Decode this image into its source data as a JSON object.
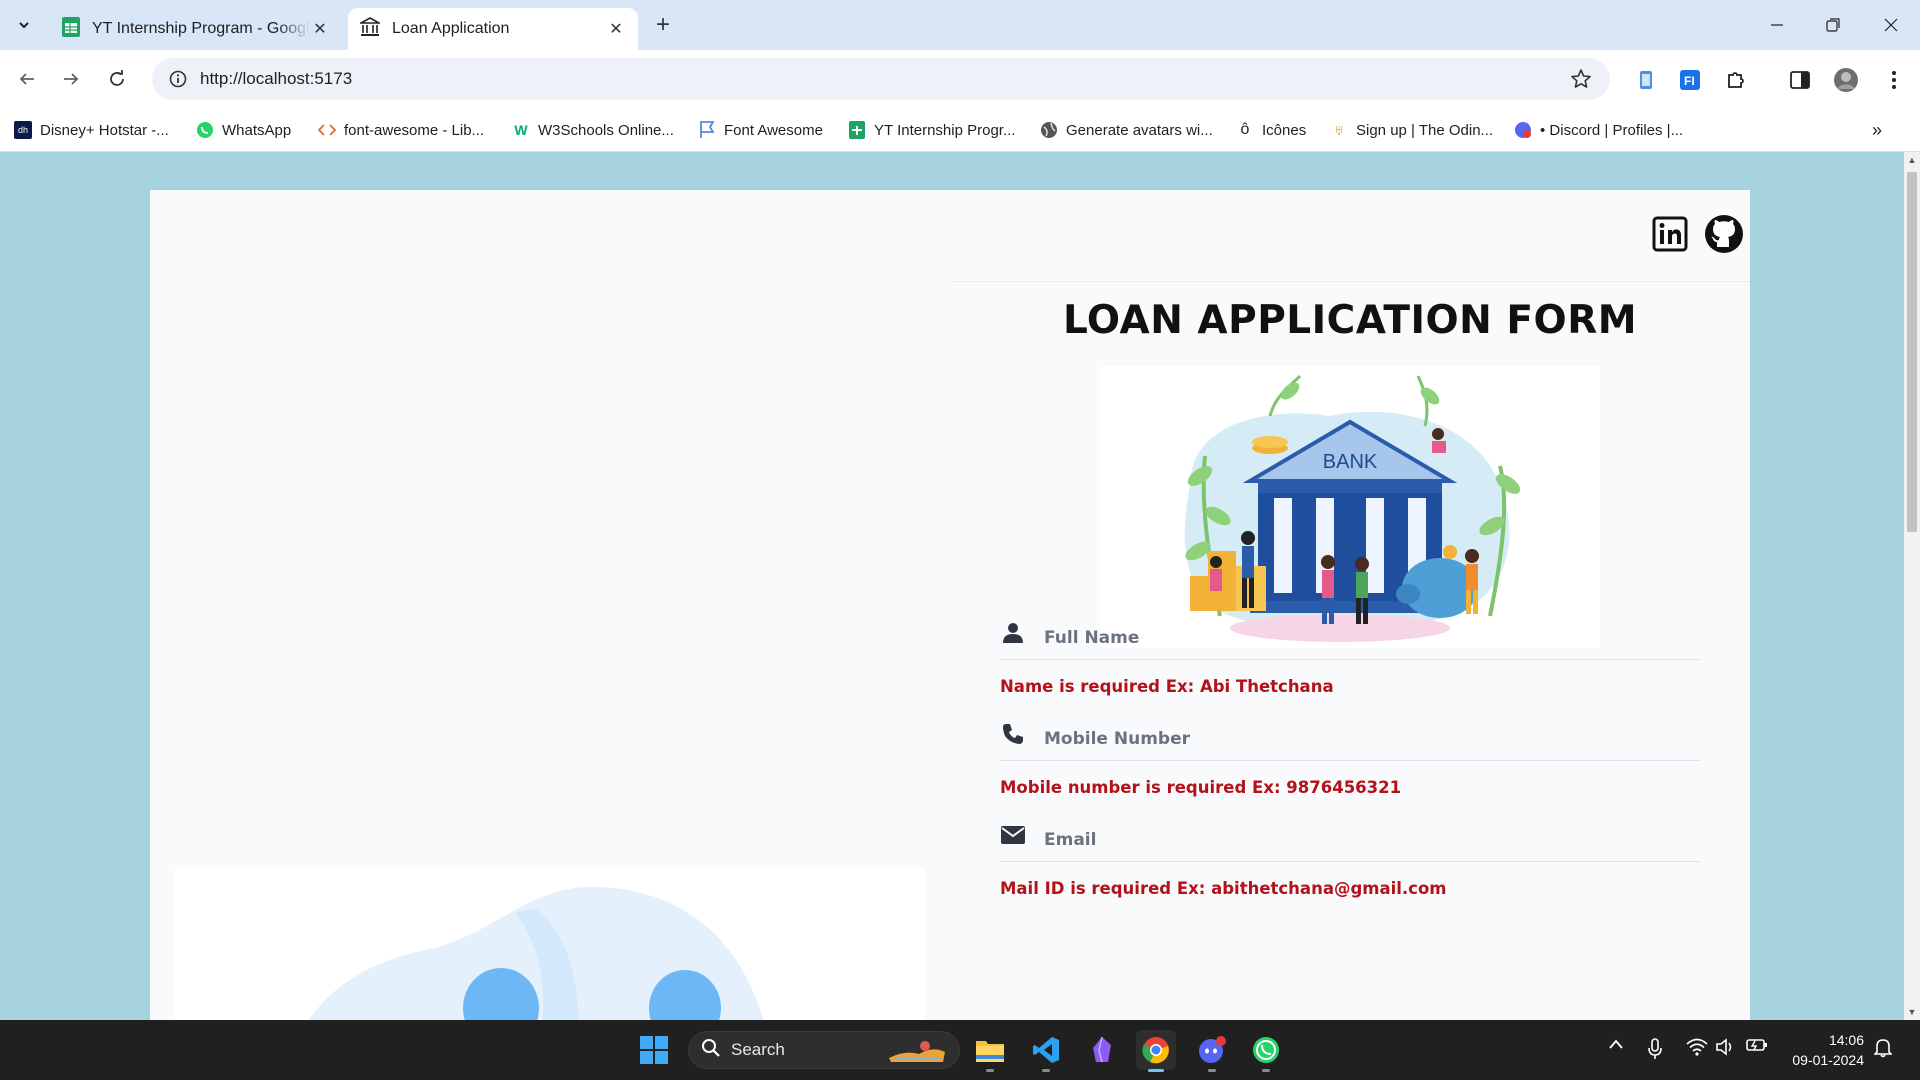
{
  "browser": {
    "tabs": [
      {
        "title": "YT Internship Program - Google Sheets",
        "active": false,
        "icon": "google-sheets-icon"
      },
      {
        "title": "Loan Application",
        "active": true,
        "icon": "bank-icon"
      }
    ],
    "url": "http://localhost:5173",
    "bookmarks": [
      {
        "label": "Disney+ Hotstar -...",
        "icon": "hotstar-icon"
      },
      {
        "label": "WhatsApp",
        "icon": "whatsapp-icon"
      },
      {
        "label": "font-awesome - Lib...",
        "icon": "code-icon"
      },
      {
        "label": "W3Schools Online...",
        "icon": "w3schools-icon"
      },
      {
        "label": "Font Awesome",
        "icon": "flag-icon"
      },
      {
        "label": "YT Internship Progr...",
        "icon": "google-sheets-icon"
      },
      {
        "label": "Generate avatars wi...",
        "icon": "globe-icon"
      },
      {
        "label": "Icônes",
        "icon": "icones-icon"
      },
      {
        "label": "Sign up | The Odin...",
        "icon": "odin-icon"
      },
      {
        "label": "• Discord | Profiles |...",
        "icon": "discord-icon"
      }
    ]
  },
  "page": {
    "title": "LOAN APPLICATION FORM",
    "image_label": "BANK",
    "fields": [
      {
        "placeholder": "Full Name",
        "value": "",
        "icon": "user-icon",
        "error": "Name is required Ex: Abi Thetchana"
      },
      {
        "placeholder": "Mobile Number",
        "value": "",
        "icon": "phone-icon",
        "error": "Mobile number is required Ex: 9876456321"
      },
      {
        "placeholder": "Email",
        "value": "",
        "icon": "envelope-icon",
        "error": "Mail ID is required Ex: abithetchana@gmail.com"
      }
    ],
    "social": [
      "linkedin-icon",
      "github-icon"
    ]
  },
  "taskbar": {
    "search_label": "Search",
    "time": "14:06",
    "date": "09-01-2024",
    "apps": [
      "windows-start-icon",
      "file-explorer-icon",
      "vscode-icon",
      "obsidian-icon",
      "chrome-icon",
      "discord-icon",
      "whatsapp-icon"
    ]
  },
  "colors": {
    "page_background": "#a6d3de",
    "error_text": "#b3121a",
    "bank_blue": "#2a5cab"
  }
}
